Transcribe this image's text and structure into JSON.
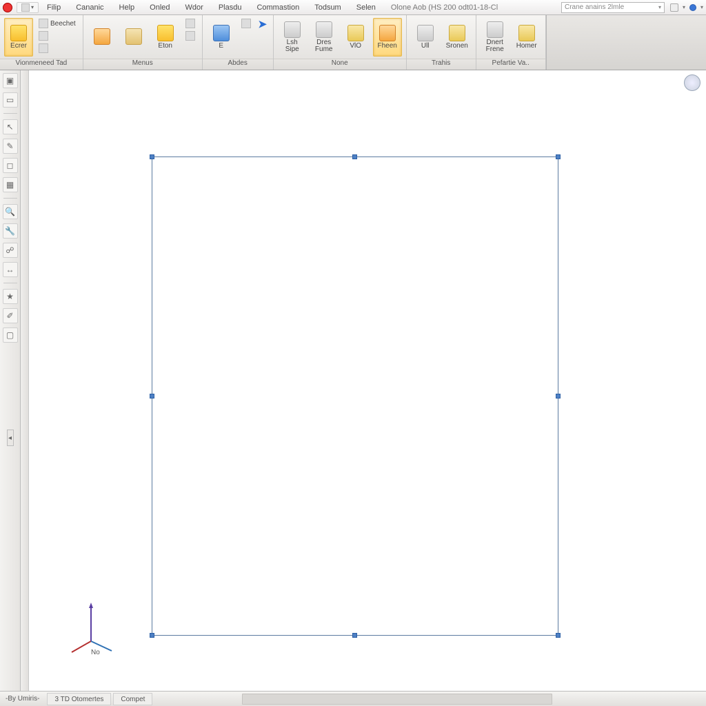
{
  "menu": {
    "items": [
      "Filip",
      "Cananic",
      "Help",
      "Onled",
      "Wdor",
      "Plasdu",
      "Commastion",
      "Todsum",
      "Selen"
    ],
    "doc_title": "Olone Aob (HS 200 odt01-18-Cl",
    "search_placeholder": "Crane anains 2lmle"
  },
  "ribbon": {
    "panels": [
      {
        "title": "Vionmeneed Tad",
        "big": [
          {
            "label": "Ecrer",
            "ico": "yel",
            "active": true
          }
        ],
        "small": [
          {
            "label": "Beechet"
          },
          {
            "label": ""
          },
          {
            "label": ""
          }
        ]
      },
      {
        "title": "Menus",
        "big": [
          {
            "label": "",
            "ico": "org"
          },
          {
            "label": "",
            "ico": "tan"
          },
          {
            "label": "Eton",
            "ico": "yel"
          }
        ],
        "small": [
          {
            "label": ""
          },
          {
            "label": ""
          }
        ]
      },
      {
        "title": "Abdes",
        "big": [
          {
            "label": "E",
            "ico": "blu"
          }
        ],
        "small": [
          {
            "label": ""
          }
        ],
        "arrow": true
      },
      {
        "title": "None",
        "big": [
          {
            "label": "Lsh\nSipe",
            "ico": "gry"
          },
          {
            "label": "Dres\nFume",
            "ico": "gry"
          },
          {
            "label": "VlO",
            "ico": "fld"
          },
          {
            "label": "Fheen",
            "ico": "org",
            "active": true
          }
        ]
      },
      {
        "title": "Trahis",
        "big": [
          {
            "label": "Ull",
            "ico": "gry"
          },
          {
            "label": "Sronen",
            "ico": "fld"
          }
        ]
      },
      {
        "title": "Pefartie Va..",
        "big": [
          {
            "label": "Dnert\nFrene",
            "ico": "gry"
          },
          {
            "label": "Homer",
            "ico": "fld"
          }
        ]
      }
    ]
  },
  "left_tools": {
    "items": [
      {
        "name": "chart-icon",
        "glyph": "▣"
      },
      {
        "name": "folder-icon",
        "glyph": "▭"
      },
      {
        "name": "pointer-icon",
        "glyph": "↖"
      },
      {
        "name": "brush-icon",
        "glyph": "✎"
      },
      {
        "name": "box-icon",
        "glyph": "◻"
      },
      {
        "name": "add-box-icon",
        "glyph": "▦"
      },
      {
        "name": "search-icon",
        "glyph": "🔍"
      },
      {
        "name": "wrench-icon",
        "glyph": "🔧"
      },
      {
        "name": "link-icon",
        "glyph": "☍"
      },
      {
        "name": "measure-icon",
        "glyph": "↔"
      },
      {
        "name": "highlight-icon",
        "glyph": "★"
      },
      {
        "name": "eyedropper-icon",
        "glyph": "✐"
      },
      {
        "name": "blank-icon",
        "glyph": "▢"
      }
    ]
  },
  "triad_label": "No",
  "status": {
    "first": "-By Umiris-",
    "items": [
      "3 TD  Otomertes",
      "Compet"
    ]
  }
}
